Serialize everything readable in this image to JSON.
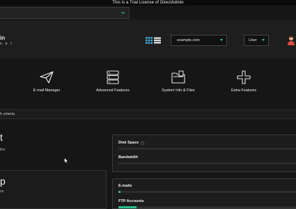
{
  "trial_banner": "This is a Trial License of DirectAdmin",
  "brand": {
    "line1": "in",
    "line2": "n e l"
  },
  "domain_selector": {
    "value": "example.com"
  },
  "user_menu": {
    "value": "User"
  },
  "features": [
    {
      "label": "E-mail Manager",
      "icon": "paper-plane-icon"
    },
    {
      "label": "Advanced Features",
      "icon": "server-icon"
    },
    {
      "label": "System Info & Files",
      "icon": "folder-icon"
    },
    {
      "label": "Extra Features",
      "icon": "plus-icon"
    }
  ],
  "filter_text": "h criteria",
  "left_stats": [
    {
      "title": "t",
      "subtitle": "tics"
    },
    {
      "title": "p",
      "subtitle": "ns"
    }
  ],
  "usage": [
    {
      "label": "Disk Space",
      "fraction": 0.0
    },
    {
      "label": "Bandwidth",
      "fraction": 0.0
    },
    {
      "label": "E-mails",
      "fraction": 0.01
    },
    {
      "label": "FTP Accounts",
      "fraction": 0.1
    }
  ],
  "colors": {
    "accent": "#2bbd8c",
    "background": "#161616",
    "panel": "#1e1e1e"
  }
}
